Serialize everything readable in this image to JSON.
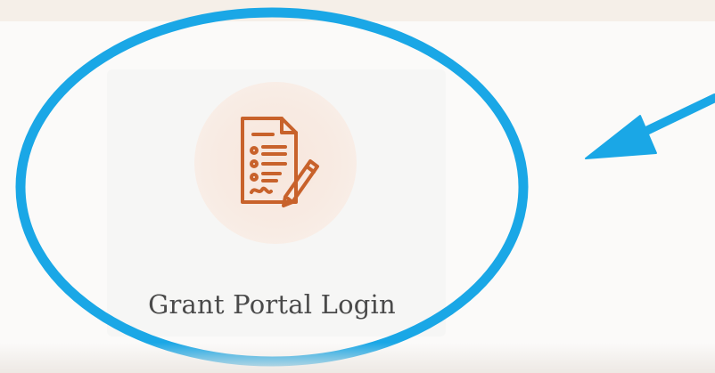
{
  "portal_tile": {
    "label": "Grant Portal Login",
    "icon": "document-signature-icon"
  },
  "colors": {
    "highlight_ring": "#1aa7e6",
    "icon_stroke": "#c8622b",
    "icon_bg": "#f7e6dc"
  }
}
